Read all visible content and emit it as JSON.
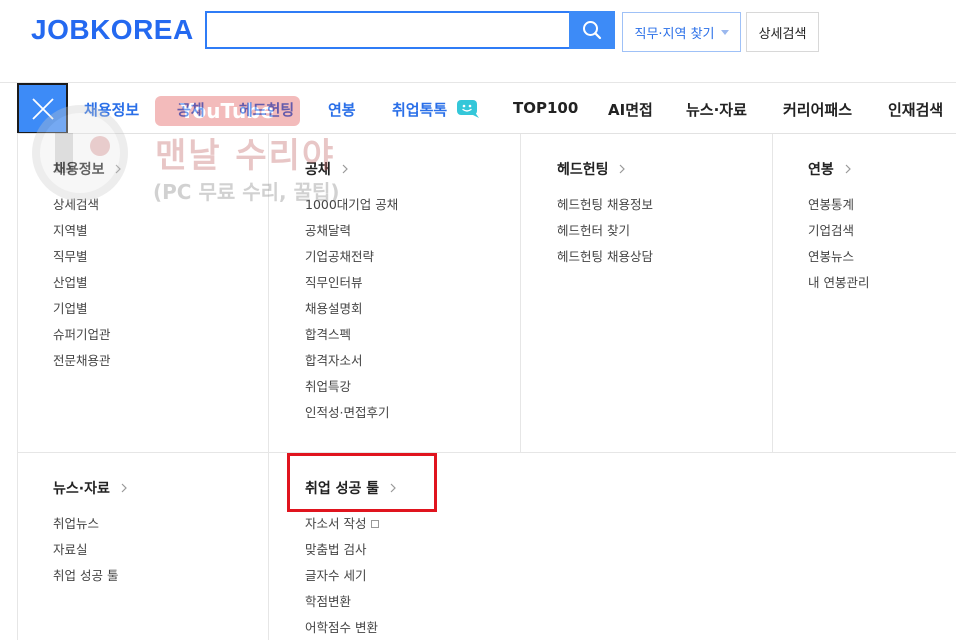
{
  "header": {
    "logo": "JOBKOREA",
    "search_value": "",
    "job_region_label": "직무·지역 찾기",
    "detail_search_label": "상세검색"
  },
  "nav": {
    "items": [
      {
        "label": "채용정보"
      },
      {
        "label": "공채"
      },
      {
        "label": "헤드헌팅"
      },
      {
        "label": "연봉"
      },
      {
        "label": "취업톡톡"
      },
      {
        "label": "TOP100"
      },
      {
        "label": "AI면접"
      },
      {
        "label": "뉴스·자료"
      },
      {
        "label": "커리어패스"
      },
      {
        "label": "인재검색"
      }
    ]
  },
  "menu": {
    "sections": [
      {
        "title": "채용정보",
        "links": [
          "상세검색",
          "지역별",
          "직무별",
          "산업별",
          "기업별",
          "슈퍼기업관",
          "전문채용관"
        ]
      },
      {
        "title": "공채",
        "links": [
          "1000대기업 공채",
          "공채달력",
          "기업공채전략",
          "직무인터뷰",
          "채용설명회",
          "합격스펙",
          "합격자소서",
          "취업특강",
          "인적성·면접후기"
        ]
      },
      {
        "title": "헤드헌팅",
        "links": [
          "헤드헌팅 채용정보",
          "헤드헌터 찾기",
          "헤드헌팅 채용상담"
        ]
      },
      {
        "title": "연봉",
        "links": [
          "연봉통계",
          "기업검색",
          "연봉뉴스",
          "내 연봉관리"
        ]
      },
      {
        "title": "뉴스·자료",
        "links": [
          "취업뉴스",
          "자료실",
          "취업 성공 툴"
        ]
      },
      {
        "title": "취업 성공 툴",
        "links": [
          "자소서 작성",
          "맞춤법 검사",
          "글자수 세기",
          "학점변환",
          "어학점수 변환"
        ]
      }
    ]
  },
  "watermark": {
    "youtube_text": "YouTube",
    "line1": "맨날 수리야",
    "line2": "(PC 무료 수리, 꿀팁)"
  },
  "colors": {
    "brand_blue": "#2469f0",
    "nav_blue": "#2a6fe8",
    "search_blue": "#3d8bf7",
    "highlight_red": "#e0141e"
  }
}
